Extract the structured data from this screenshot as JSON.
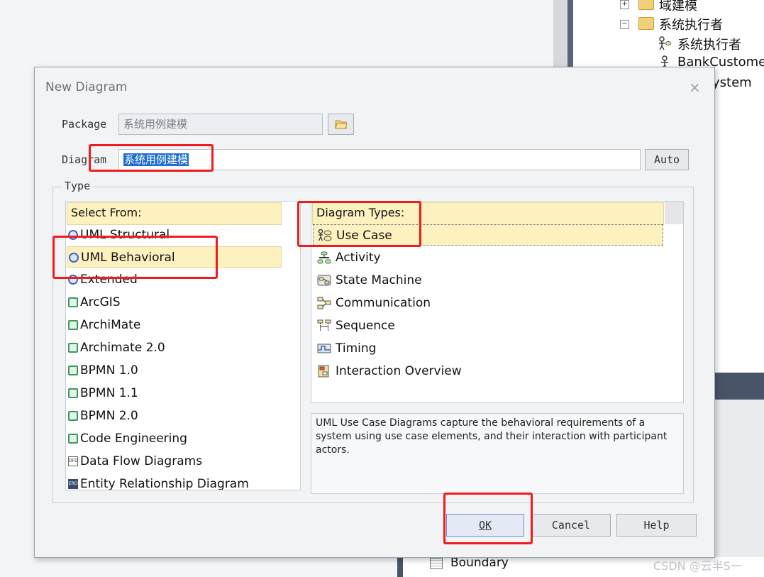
{
  "background": {
    "tree_items": [
      {
        "label": "域建模",
        "expander": "+"
      },
      {
        "label": "系统执行者",
        "expander": "−"
      },
      {
        "label": "系统执行者"
      },
      {
        "label": "BankCustomer"
      },
      {
        "label": "ystem"
      }
    ],
    "boundary_label": "Boundary",
    "watermark": "CSDN @云半S一"
  },
  "dialog": {
    "title": "New Diagram",
    "close_symbol": "×",
    "package_label": "Package",
    "package_value": "系统用例建模",
    "diagram_label": "Diagram",
    "diagram_value": "系统用例建模",
    "auto_button": "Auto",
    "type_group_label": "Type",
    "select_from": {
      "header": "Select From:",
      "items": [
        {
          "label": "UML Structural",
          "icon": "uml-icon"
        },
        {
          "label": "UML Behavioral",
          "icon": "uml-icon",
          "selected": true
        },
        {
          "label": "Extended",
          "icon": "uml-icon"
        },
        {
          "label": "ArcGIS",
          "icon": "mdg-icon"
        },
        {
          "label": "ArchiMate",
          "icon": "mdg-icon"
        },
        {
          "label": "Archimate 2.0",
          "icon": "mdg-icon"
        },
        {
          "label": "BPMN 1.0",
          "icon": "mdg-icon"
        },
        {
          "label": "BPMN 1.1",
          "icon": "mdg-icon"
        },
        {
          "label": "BPMN 2.0",
          "icon": "mdg-icon"
        },
        {
          "label": "Code Engineering",
          "icon": "mdg-icon"
        },
        {
          "label": "Data Flow Diagrams",
          "icon": "dfd-icon"
        },
        {
          "label": "Entity Relationship Diagram",
          "icon": "erd-icon"
        }
      ]
    },
    "diagram_types": {
      "header": "Diagram Types:",
      "items": [
        {
          "label": "Use Case",
          "icon": "use-case-icon",
          "selected": true
        },
        {
          "label": "Activity",
          "icon": "activity-icon"
        },
        {
          "label": "State Machine",
          "icon": "state-machine-icon"
        },
        {
          "label": "Communication",
          "icon": "communication-icon"
        },
        {
          "label": "Sequence",
          "icon": "sequence-icon"
        },
        {
          "label": "Timing",
          "icon": "timing-icon"
        },
        {
          "label": "Interaction Overview",
          "icon": "interaction-overview-icon"
        }
      ]
    },
    "description": "UML Use Case Diagrams capture the behavioral requirements of a system using use case elements, and their interaction with participant actors.",
    "buttons": {
      "ok": "OK",
      "cancel": "Cancel",
      "help": "Help"
    }
  },
  "colors": {
    "selection_bg": "#fdf1bf",
    "annotation_red": "#ee1c1c",
    "dialog_bg": "#f2f3f5"
  }
}
